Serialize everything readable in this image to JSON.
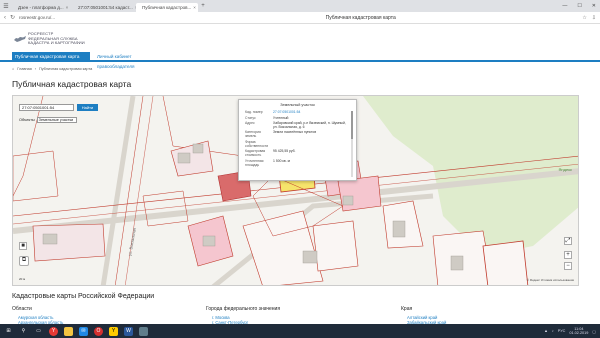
{
  "browser": {
    "tabs": [
      {
        "label": "Дзен - платформа д...",
        "favicon_color": "#222"
      },
      {
        "label": "27:07:0501001:54 кадаст...",
        "favicon_color": "#1d7ec2"
      },
      {
        "label": "Публичная кадастров...",
        "favicon_color": "#2e7d32",
        "active": true
      }
    ],
    "url": "rosreestr.gov.ru/...",
    "page_title": "Публичная кадастровая карта"
  },
  "site": {
    "logo_line1": "Росреестр",
    "logo_line2": "Федеральная служба",
    "logo_line3": "кадастра и картографии",
    "nav": {
      "primary": "Публичная кадастровая карта",
      "secondary": "Личный кабинет правообладателя"
    },
    "breadcrumb": [
      "Главная",
      "Публичная кадастровая карта"
    ],
    "page_title": "Публичная кадастровая карта"
  },
  "map": {
    "search_value": "27:07:0501001:54",
    "search_button": "Найти",
    "layer_label": "Объекты",
    "layer_value": "Земельные участки",
    "zoom_in": "+",
    "zoom_out": "−",
    "fullscreen": "⤢",
    "yandex_label": "Яндекс",
    "attribution": "© Яндекс  Условия использования",
    "scale": "20 м",
    "popup": {
      "title": "Земельный участок",
      "rows": [
        {
          "k": "Кад. номер",
          "v": "27:07:0501001:54",
          "link": true
        },
        {
          "k": "Статус",
          "v": "Учтенный"
        },
        {
          "k": "Адрес",
          "v": "Хабаровский край, р-н Вяземский, п. Шумный, ул. Вокзальная, д. 6",
          "link": false
        },
        {
          "k": "Категория земель",
          "v": "Земли населённых пунктов"
        },
        {
          "k": "Форма собственности",
          "v": ""
        },
        {
          "k": "Кадастровая стоимость",
          "v": "95 425,55 руб."
        },
        {
          "k": "Уточненная площадь",
          "v": "1 500 кв. м"
        }
      ]
    }
  },
  "lower": {
    "section_title": "Кадастровые карты Российской Федерации",
    "columns": [
      {
        "heading": "Области",
        "links": [
          "Амурская область",
          "Архангельская область"
        ]
      },
      {
        "heading": "Города федерального значения",
        "links": [
          "г. Москва",
          "г. Санкт-Петербург"
        ]
      },
      {
        "heading": "Края",
        "links": [
          "Алтайский край",
          "Забайкальский край"
        ]
      }
    ]
  },
  "taskbar": {
    "lang": "РУС",
    "time": "11:04",
    "date": "01.02.2019"
  },
  "colors": {
    "accent": "#1d7ec2",
    "parcel_line": "#c0392b",
    "highlight": "#f6e46b"
  }
}
